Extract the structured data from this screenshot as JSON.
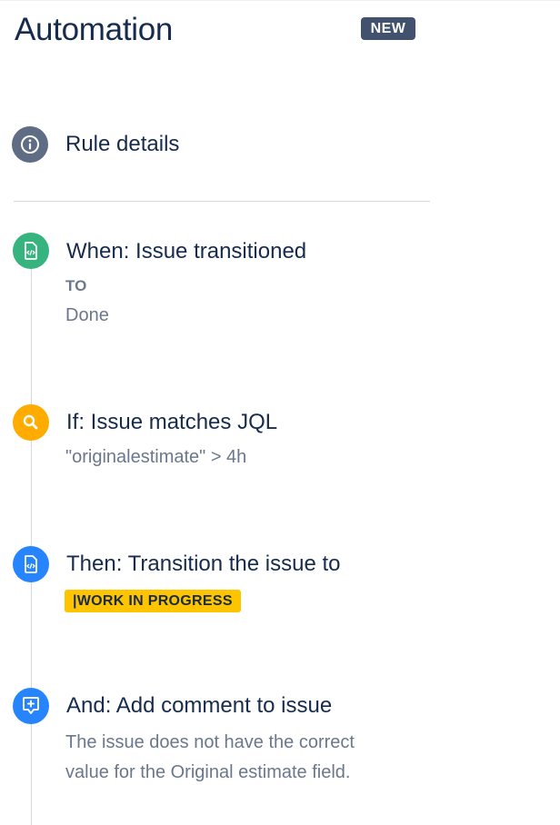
{
  "header": {
    "title": "Automation",
    "badge": "NEW"
  },
  "rule_details": {
    "label": "Rule details",
    "icon": "info-icon"
  },
  "steps": [
    {
      "title": "When: Issue transitioned",
      "icon": "trigger-icon",
      "color": "#36b37e",
      "field_label": "TO",
      "value": "Done"
    },
    {
      "title": "If: Issue matches JQL",
      "icon": "search-icon",
      "color": "#ffab00",
      "value": "\"originalestimate\" > 4h"
    },
    {
      "title": "Then: Transition the issue to",
      "icon": "action-icon",
      "color": "#2684ff",
      "status": "|WORK IN PROGRESS",
      "status_color": "#ffc400"
    },
    {
      "title": "And: Add comment to issue",
      "icon": "add-comment-icon",
      "color": "#2684ff",
      "value_line1": "The issue does not have the correct",
      "value_line2": "value for the Original estimate field."
    }
  ]
}
